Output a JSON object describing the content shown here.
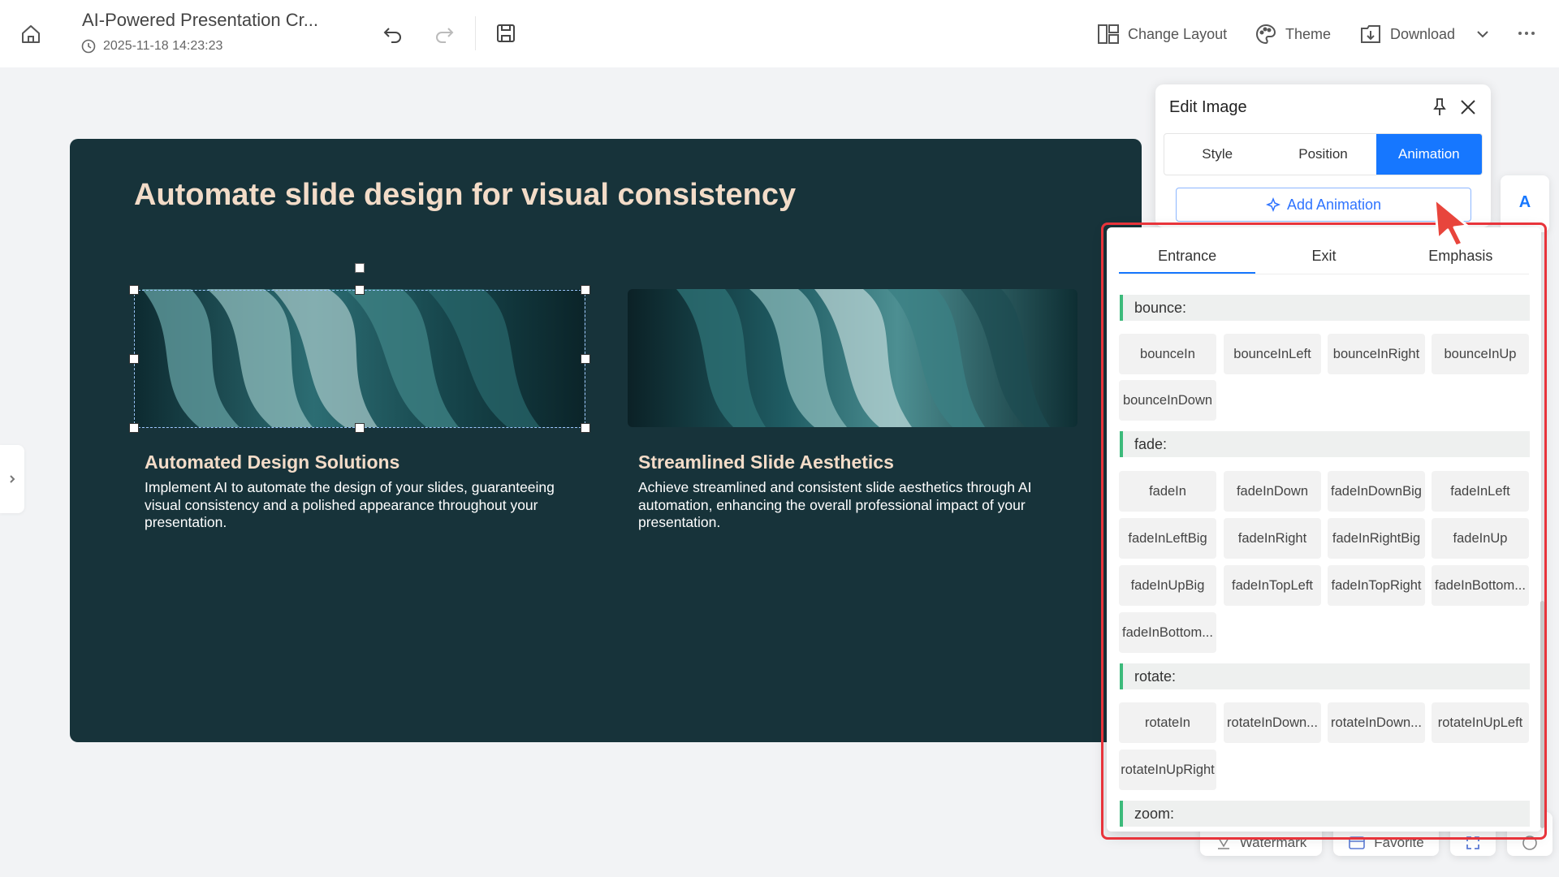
{
  "header": {
    "doc_title": "AI-Powered Presentation Cr...",
    "timestamp": "2025-11-18 14:23:23",
    "actions": {
      "change_layout": "Change Layout",
      "theme": "Theme",
      "download": "Download"
    }
  },
  "slide": {
    "title": "Automate slide design for visual consistency",
    "cards": [
      {
        "title": "Automated Design Solutions",
        "desc": "Implement AI to automate the design of your slides, guaranteeing visual consistency and a polished appearance throughout your presentation."
      },
      {
        "title": "Streamlined Slide Aesthetics",
        "desc": "Achieve streamlined and consistent slide aesthetics through AI automation, enhancing the overall professional impact of your presentation."
      }
    ]
  },
  "edit_panel": {
    "title": "Edit Image",
    "tabs": [
      "Style",
      "Position",
      "Animation"
    ],
    "add_animation": "Add Animation"
  },
  "side_toolbar": {
    "text_icon": "A"
  },
  "bottom_bar": {
    "watermark": "Watermark",
    "favorite": "Favorite"
  },
  "animation_menu": {
    "tabs": [
      "Entrance",
      "Exit",
      "Emphasis"
    ],
    "sections": [
      {
        "label": "bounce:",
        "items": [
          "bounceIn",
          "bounceInLeft",
          "bounceInRight",
          "bounceInUp",
          "bounceInDown"
        ]
      },
      {
        "label": "fade:",
        "items": [
          "fadeIn",
          "fadeInDown",
          "fadeInDownBig",
          "fadeInLeft",
          "fadeInLeftBig",
          "fadeInRight",
          "fadeInRightBig",
          "fadeInUp",
          "fadeInUpBig",
          "fadeInTopLeft",
          "fadeInTopRight",
          "fadeInBottom...",
          "fadeInBottom..."
        ]
      },
      {
        "label": "rotate:",
        "items": [
          "rotateIn",
          "rotateInDown...",
          "rotateInDown...",
          "rotateInUpLeft",
          "rotateInUpRight"
        ]
      },
      {
        "label": "zoom:",
        "items": []
      }
    ]
  },
  "colors": {
    "accent": "#1677ff",
    "slide_bg": "#17333a",
    "slide_heading": "#f3dcc8",
    "section_marker": "#3cba7b",
    "highlight": "#e8343b"
  }
}
